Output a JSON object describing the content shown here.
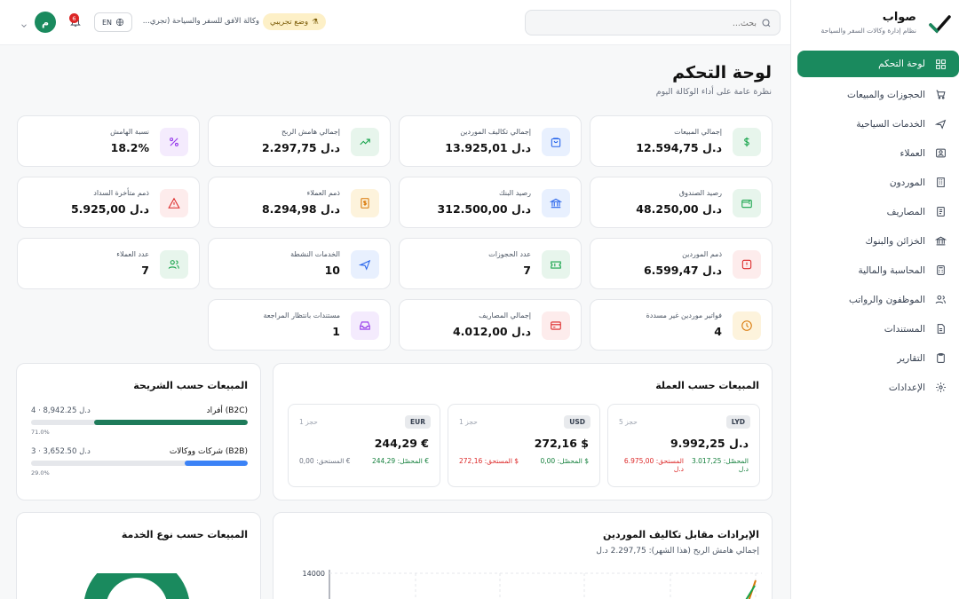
{
  "brand": {
    "name": "صواب",
    "subtitle": "نظام إدارة وكالات السفر والسياحة"
  },
  "sidebar": {
    "items": [
      {
        "label": "لوحة التحكم",
        "icon": "grid-icon",
        "active": true
      },
      {
        "label": "الحجوزات والمبيعات",
        "icon": "cart-icon"
      },
      {
        "label": "الخدمات السياحية",
        "icon": "plane-icon"
      },
      {
        "label": "العملاء",
        "icon": "user-card-icon"
      },
      {
        "label": "الموردون",
        "icon": "building-icon"
      },
      {
        "label": "المصاريف",
        "icon": "receipt-icon"
      },
      {
        "label": "الخزائن والبنوك",
        "icon": "bank-icon"
      },
      {
        "label": "المحاسبة والمالية",
        "icon": "calculator-icon"
      },
      {
        "label": "الموظفون والرواتب",
        "icon": "users-icon"
      },
      {
        "label": "المستندات",
        "icon": "document-icon"
      },
      {
        "label": "التقارير",
        "icon": "clipboard-icon"
      },
      {
        "label": "الإعدادات",
        "icon": "gear-icon"
      }
    ]
  },
  "topbar": {
    "search_placeholder": "بحث...",
    "demo_badge": "وضع تجريبي",
    "agency_name": "وكالة الأفق للسفر والسياحة (تجري...",
    "lang": "EN",
    "notif_count": "6",
    "avatar_initial": "م"
  },
  "page": {
    "title": "لوحة التحكم",
    "subtitle": "نظرة عامة على أداء الوكالة اليوم"
  },
  "stats": [
    {
      "label": "إجمالي المبيعات",
      "value": "12.594,75 د.ل",
      "icon": "dollar-icon",
      "color": "#16a34a",
      "bg": "#e7f5ec"
    },
    {
      "label": "إجمالي تكاليف الموردين",
      "value": "13.925,01 د.ل",
      "icon": "bag-icon",
      "color": "#2563eb",
      "bg": "#e8f0fe"
    },
    {
      "label": "إجمالي هامش الربح",
      "value": "2.297,75 د.ل",
      "icon": "trend-up-icon",
      "color": "#16a34a",
      "bg": "#e7f5ec"
    },
    {
      "label": "نسبة الهامش",
      "value": "18.2%",
      "icon": "percent-icon",
      "color": "#9333ea",
      "bg": "#f4ebfd"
    },
    {
      "label": "رصيد الصندوق",
      "value": "48.250,00 د.ل",
      "icon": "wallet-icon",
      "color": "#16a34a",
      "bg": "#e7f5ec"
    },
    {
      "label": "رصيد البنك",
      "value": "312.500,00 د.ل",
      "icon": "bank-icon",
      "color": "#2563eb",
      "bg": "#e8f0fe"
    },
    {
      "label": "ذمم العملاء",
      "value": "8.294,98 د.ل",
      "icon": "invoice-icon",
      "color": "#d97706",
      "bg": "#fdf3dc"
    },
    {
      "label": "ذمم متأخرة السداد",
      "value": "5.925,00 د.ل",
      "icon": "alert-triangle-icon",
      "color": "#dc2626",
      "bg": "#fdecec"
    },
    {
      "label": "ذمم الموردين",
      "value": "6.599,47 د.ل",
      "icon": "alert-square-icon",
      "color": "#dc2626",
      "bg": "#fdecec"
    },
    {
      "label": "عدد الحجوزات",
      "value": "7",
      "icon": "ticket-icon",
      "color": "#16a34a",
      "bg": "#e7f5ec"
    },
    {
      "label": "الخدمات النشطة",
      "value": "10",
      "icon": "plane-icon",
      "color": "#2563eb",
      "bg": "#e8f0fe"
    },
    {
      "label": "عدد العملاء",
      "value": "7",
      "icon": "users-icon",
      "color": "#16a34a",
      "bg": "#e7f5ec"
    },
    {
      "label": "فواتير موردين غير مسددة",
      "value": "4",
      "icon": "clock-icon",
      "color": "#d97706",
      "bg": "#fdf3dc"
    },
    {
      "label": "إجمالي المصاريف",
      "value": "4.012,00 د.ل",
      "icon": "credit-card-icon",
      "color": "#dc2626",
      "bg": "#fdecec"
    },
    {
      "label": "مستندات بانتظار المراجعة",
      "value": "1",
      "icon": "inbox-icon",
      "color": "#9333ea",
      "bg": "#f4ebfd"
    }
  ],
  "sales_by_currency": {
    "title": "المبيعات حسب العملة",
    "items": [
      {
        "code": "LYD",
        "count": "5 حجز",
        "amount": "9.992,25 د.ل",
        "collected": "المحصّل: 3.017,25 د.ل",
        "due": "المستحق: 6.975,00 د.ل",
        "due_color": "#dc2626"
      },
      {
        "code": "USD",
        "count": "1 حجز",
        "amount": "272,16 $",
        "collected": "المحصّل: 0,00 $",
        "due": "المستحق: 272,16 $",
        "due_color": "#dc2626"
      },
      {
        "code": "EUR",
        "count": "1 حجز",
        "amount": "244,29 €",
        "collected": "المحصّل: 244,29 €",
        "due": "المستحق: 0,00 €",
        "due_color": "#6b7280"
      }
    ]
  },
  "sales_by_segment": {
    "title": "المبيعات حسب الشريحة",
    "items": [
      {
        "name": "أفراد (B2C)",
        "value": "4 · 8,942.25 د.ل",
        "pct_label": "71.0%",
        "pct": 71.0,
        "color": "#1e7b5a"
      },
      {
        "name": "شركات ووكالات (B2B)",
        "value": "3 · 3,652.50 د.ل",
        "pct_label": "29.0%",
        "pct": 29.0,
        "color": "#3b82f6"
      }
    ]
  },
  "revenue_chart": {
    "title": "الإيرادات مقابل تكاليف الموردين",
    "subtitle": "إجمالي هامش الربح (هذا الشهر): 2.297,75 د.ل",
    "y_tick_top": "14000"
  },
  "chart_data": {
    "type": "line",
    "title": "الإيرادات مقابل تكاليف الموردين",
    "ylim": [
      0,
      14000
    ],
    "y_ticks": [
      14000
    ],
    "grid": true
  },
  "service_chart": {
    "title": "المبيعات حسب نوع الخدمة"
  }
}
